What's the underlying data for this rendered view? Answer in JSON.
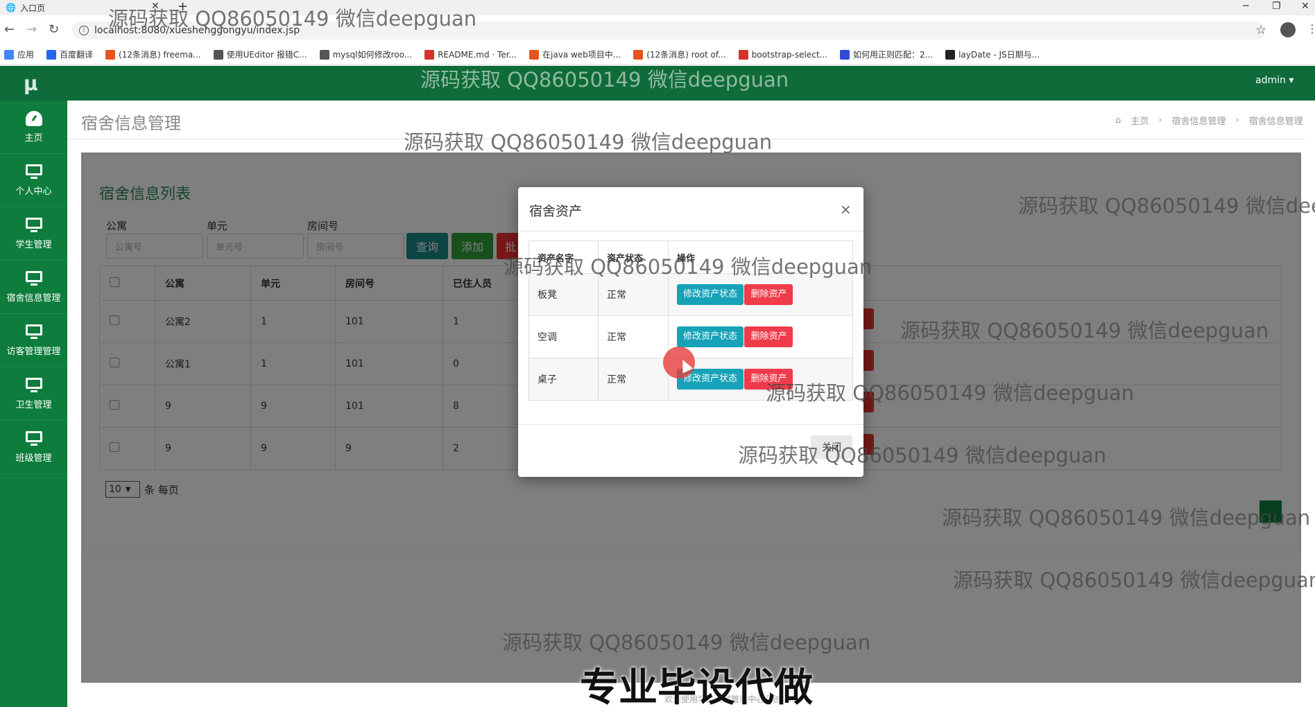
{
  "browser": {
    "tab_title": "入口页",
    "url": "localhost:8080/xueshenggongyu/index.jsp",
    "bookmarks": [
      {
        "label": "应用",
        "color": "#4285f4"
      },
      {
        "label": "百度翻译",
        "color": "#2468f2"
      },
      {
        "label": "(12条消息) freema...",
        "color": "#e8541d"
      },
      {
        "label": "使用UEditor 报错C...",
        "color": "#555555"
      },
      {
        "label": "mysql如何修改roo...",
        "color": "#555555"
      },
      {
        "label": "README.md · Ter...",
        "color": "#d6312a"
      },
      {
        "label": "在java web项目中...",
        "color": "#e8541d"
      },
      {
        "label": "(12条消息) root of...",
        "color": "#e8541d"
      },
      {
        "label": "bootstrap-select...",
        "color": "#d6312a"
      },
      {
        "label": "如何用正则匹配：2...",
        "color": "#2f4bd6"
      },
      {
        "label": "layDate - JS日期与...",
        "color": "#222222"
      }
    ]
  },
  "app": {
    "logo": "μ",
    "user": "admin ▾",
    "sidebar": [
      {
        "label": "主页",
        "icon": "dashboard-icon"
      },
      {
        "label": "个人中心",
        "icon": "monitor-icon"
      },
      {
        "label": "学生管理",
        "icon": "monitor-icon"
      },
      {
        "label": "宿舍信息管理",
        "icon": "monitor-icon"
      },
      {
        "label": "访客管理管理",
        "icon": "monitor-icon"
      },
      {
        "label": "卫生管理",
        "icon": "monitor-icon"
      },
      {
        "label": "班级管理",
        "icon": "monitor-icon"
      }
    ],
    "page_title": "宿舍信息管理",
    "breadcrumb": [
      "主页",
      "宿舍信息管理",
      "宿舍信息管理"
    ],
    "panel_title": "宿舍信息列表",
    "filters": [
      {
        "label": "公寓",
        "placeholder": "公寓号"
      },
      {
        "label": "单元",
        "placeholder": "单元号"
      },
      {
        "label": "房间号",
        "placeholder": "房间号"
      }
    ],
    "buttons": {
      "search": "查询",
      "add": "添加",
      "batch": "批"
    },
    "table": {
      "headers": [
        "公寓",
        "单元",
        "房间号",
        "已住人员"
      ],
      "rows": [
        [
          "公寓2",
          "1",
          "101",
          "1"
        ],
        [
          "公寓1",
          "1",
          "101",
          "0"
        ],
        [
          "9",
          "9",
          "101",
          "8"
        ],
        [
          "9",
          "9",
          "9",
          "2"
        ]
      ]
    },
    "pager": {
      "page_size": "10",
      "suffix": "条 每页"
    },
    "footer": "欢迎使用学生公寓管理中心系统"
  },
  "modal": {
    "title": "宿舍资产",
    "close_x": "×",
    "headers": [
      "资产名字",
      "资产状态",
      "操作"
    ],
    "rows": [
      {
        "name": "板凳",
        "status": "正常"
      },
      {
        "name": "空调",
        "status": "正常"
      },
      {
        "name": "桌子",
        "status": "正常"
      }
    ],
    "edit_label": "修改资产状态",
    "delete_label": "删除资产",
    "close_label": "关闭"
  },
  "watermark": "源码获取 QQ86050149 微信deepguan",
  "banner": "专业毕设代做",
  "colors": {
    "sidebar": "#0e7c3c",
    "topbar": "#0f6b3a",
    "edit_btn": "#17a2b8",
    "delete_btn": "#ef3b4a",
    "search_btn": "#1a8a8a",
    "add_btn": "#2e9e3a"
  }
}
